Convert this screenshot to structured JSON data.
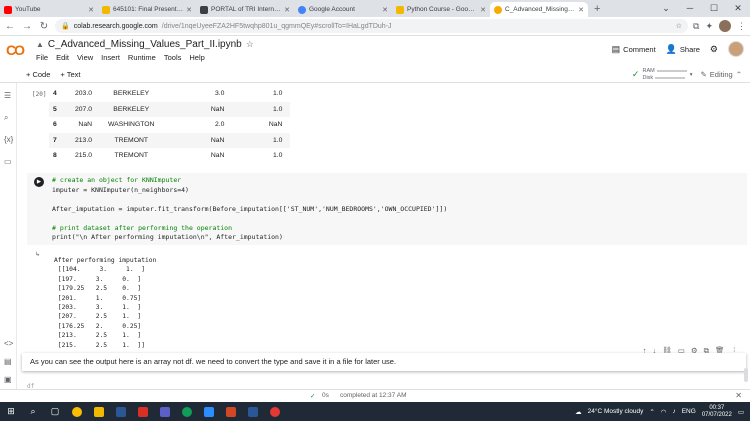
{
  "browser": {
    "tabs": [
      {
        "label": "YouTube",
        "color": "#ff0000",
        "active": false
      },
      {
        "label": "645101: Final Presentation",
        "color": "#f2b900",
        "active": false
      },
      {
        "label": "PORTAL of TRI Internal V",
        "color": "#3c4043",
        "active": false
      },
      {
        "label": "Google Account",
        "color": "#4285f4",
        "active": false
      },
      {
        "label": "Python Course - Google Dr",
        "color": "#f2b900",
        "active": false
      },
      {
        "label": "C_Advanced_Missing_Value",
        "color": "#f9ab00",
        "active": true
      }
    ],
    "new_tab": "+",
    "url_host": "colab.research.google.com",
    "url_path": "/drive/1nqeUyeeFZA2HF5twqhp801u_qgmmQEy#scrollTo=IHaLgdTDuh-J"
  },
  "colab": {
    "logo": "CO",
    "title": "C_Advanced_Missing_Values_Part_II.ipynb",
    "menu": [
      "File",
      "Edit",
      "View",
      "Insert",
      "Runtime",
      "Tools",
      "Help"
    ],
    "comment_label": "Comment",
    "share_label": "Share",
    "add_code": "+ Code",
    "add_text": "+ Text",
    "ram_label": "RAM",
    "disk_label": "Disk",
    "editing_label": "Editing"
  },
  "dataframe": {
    "exec_count": "[20]",
    "rows": [
      [
        "4",
        "203.0",
        "BERKELEY",
        "3.0",
        "1.0"
      ],
      [
        "5",
        "207.0",
        "BERKELEY",
        "NaN",
        "1.0"
      ],
      [
        "6",
        "NaN",
        "WASHINGTON",
        "2.0",
        "NaN"
      ],
      [
        "7",
        "213.0",
        "TREMONT",
        "NaN",
        "1.0"
      ],
      [
        "8",
        "215.0",
        "TREMONT",
        "NaN",
        "1.0"
      ]
    ]
  },
  "code_cell": {
    "line1": "# create an object for KNNImputer",
    "line2": "imputer = KNNImputer(n_neighbors=4)",
    "line3": "After_imputation = imputer.fit_transform(Before_imputation[['ST_NUM','NUM_BEDROOMS','OWN_OCCUPIED']])",
    "line4": "# print dataset after performing the operation",
    "line5": "print(\"\\n After performing imputation\\n\", After_imputation)"
  },
  "output": {
    "text": "After performing imputation\n [[104.     3.     1.  ]\n [197.     3.     0.  ]\n [179.25   2.5    0.  ]\n [201.     1.     0.75]\n [203.     3.     1.  ]\n [207.     2.5    1.  ]\n [176.25   2.     0.25]\n [213.     2.5    1.  ]\n [215.     2.5    1.  ]]"
  },
  "text_cell": {
    "text": "As you can see the output here is an array not df. we need to convert the type and save it in a file for later use."
  },
  "next_cell_preview": "df",
  "status": {
    "check": "✓",
    "duration": "0s",
    "completed": "completed at 12:37 AM"
  },
  "taskbar": {
    "weather": "24°C  Mostly cloudy",
    "lang": "ENG",
    "time": "00:37",
    "date": "07/07/2022"
  }
}
